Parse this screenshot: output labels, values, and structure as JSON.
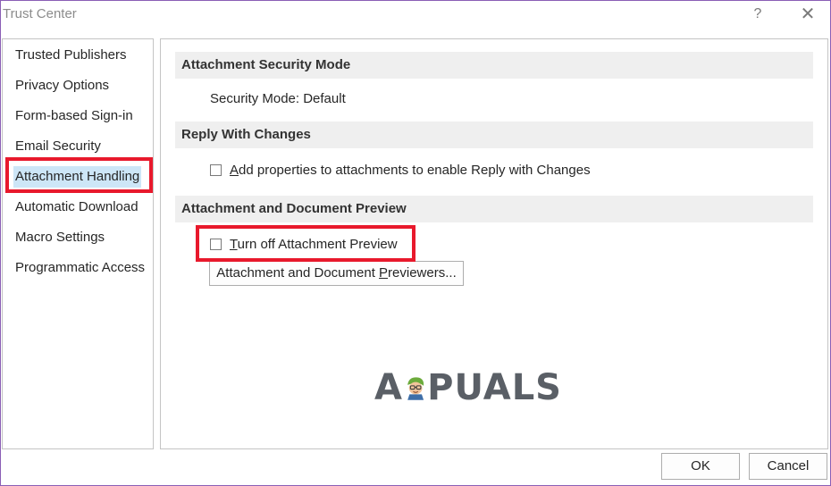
{
  "window": {
    "title": "Trust Center",
    "help_glyph": "?",
    "close_glyph": "✕"
  },
  "sidebar": {
    "items": [
      {
        "label": "Trusted Publishers"
      },
      {
        "label": "Privacy Options"
      },
      {
        "label": "Form-based Sign-in"
      },
      {
        "label": "Email Security"
      },
      {
        "label": "Attachment Handling",
        "selected": true
      },
      {
        "label": "Automatic Download"
      },
      {
        "label": "Macro Settings"
      },
      {
        "label": "Programmatic Access"
      }
    ]
  },
  "content": {
    "security_mode_section": {
      "header": "Attachment Security Mode",
      "status": "Security Mode: Default"
    },
    "reply_section": {
      "header": "Reply With Changes",
      "checkbox": {
        "label_accel": "A",
        "label_rest": "dd properties to attachments to enable Reply with Changes",
        "checked": false
      }
    },
    "preview_section": {
      "header": "Attachment and Document Preview",
      "checkbox": {
        "label_accel": "T",
        "label_rest": "urn off Attachment Preview",
        "checked": false
      },
      "previewers_button": {
        "label_before": "Attachment and Document ",
        "label_accel": "P",
        "label_after": "reviewers..."
      }
    }
  },
  "footer": {
    "ok_label": "OK",
    "cancel_label": "Cancel"
  },
  "watermark": {
    "text_left": "A",
    "text_right": "PUALS"
  },
  "colors": {
    "highlight": "#e8192c",
    "selection": "#cde6f7",
    "section_header_bg": "#efefef",
    "window_border": "#8a5fb5"
  }
}
